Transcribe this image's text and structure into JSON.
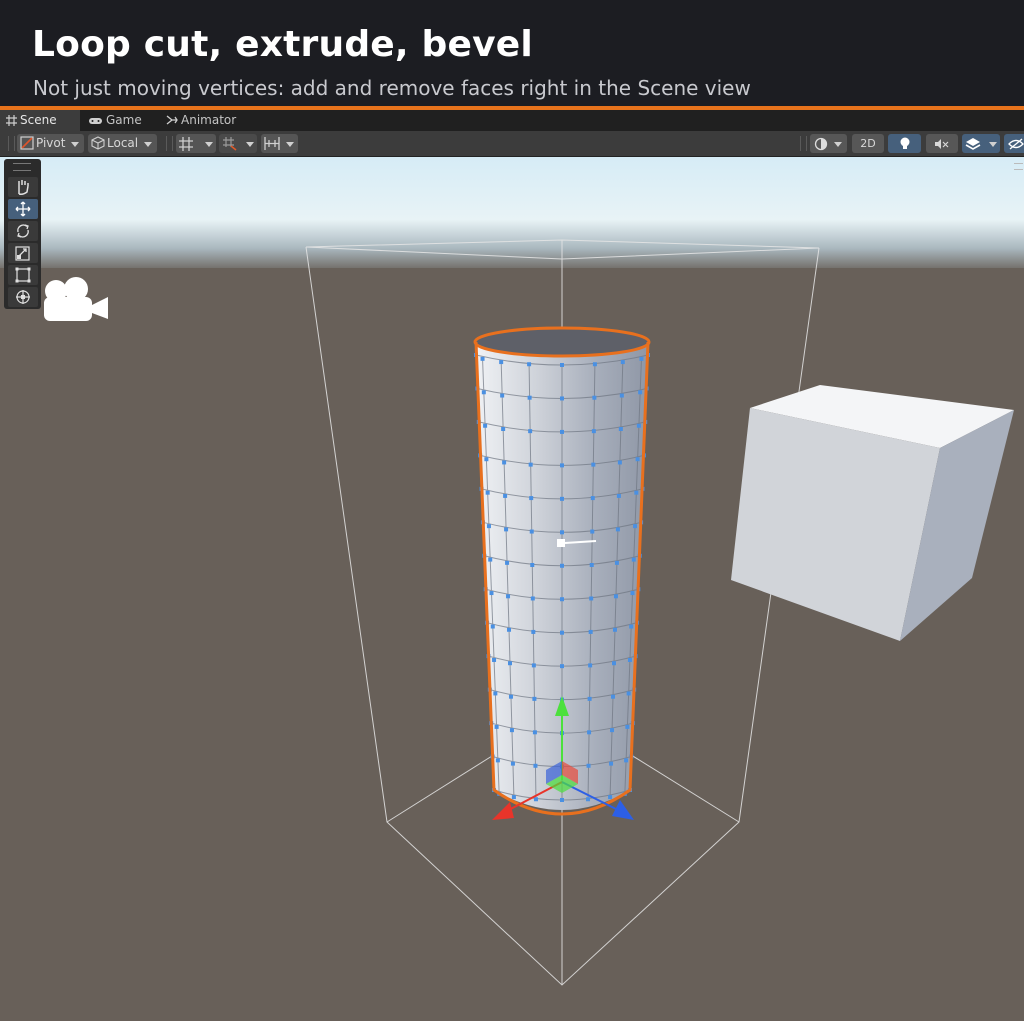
{
  "banner": {
    "title": "Loop cut, extrude, bevel",
    "subtitle": "Not just moving vertices: add and remove faces right in the Scene view"
  },
  "tabs": [
    {
      "label": "Scene",
      "icon": "scene-grid-icon",
      "active": true
    },
    {
      "label": "Game",
      "icon": "gamepad-icon",
      "active": false
    },
    {
      "label": "Animator",
      "icon": "animator-icon",
      "active": false
    }
  ],
  "toolbar": {
    "pivot_label": "Pivot",
    "local_label": "Local",
    "two_d_label": "2D"
  },
  "tools": [
    {
      "name": "hand-tool",
      "icon": "hand-icon",
      "selected": false
    },
    {
      "name": "move-tool",
      "icon": "move-icon",
      "selected": true
    },
    {
      "name": "rotate-tool",
      "icon": "rotate-icon",
      "selected": false
    },
    {
      "name": "scale-tool",
      "icon": "scale-icon",
      "selected": false
    },
    {
      "name": "rect-tool",
      "icon": "rect-icon",
      "selected": false
    },
    {
      "name": "transform-tool",
      "icon": "transform-icon",
      "selected": false
    }
  ],
  "colors": {
    "accent": "#e8731c",
    "selection_outline": "#e8701e",
    "vertex": "#4a90e2",
    "gizmo_x": "#e8342a",
    "gizmo_y": "#4ce03c",
    "gizmo_z": "#2c5fe6",
    "ground": "#686059",
    "sky_top": "#d6ecf6"
  }
}
